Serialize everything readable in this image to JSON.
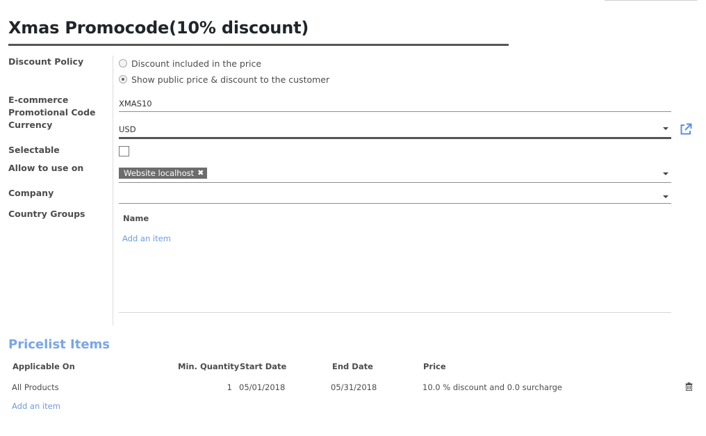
{
  "form": {
    "title": "Xmas Promocode(10% discount)",
    "labels": {
      "discount_policy": "Discount Policy",
      "promo_code_line1": "E-commerce",
      "promo_code_line2": "Promotional Code",
      "currency": "Currency",
      "selectable": "Selectable",
      "allow_to_use_on": "Allow to use on",
      "company": "Company",
      "country_groups": "Country Groups"
    },
    "discount_policy": {
      "options": [
        {
          "label": "Discount included in the price",
          "selected": false
        },
        {
          "label": "Show public price & discount to the customer",
          "selected": true
        }
      ]
    },
    "promo_code": "XMAS10",
    "currency": "USD",
    "selectable": false,
    "allow_to_use_on": {
      "tags": [
        "Website localhost"
      ],
      "remove_glyph": "✖"
    },
    "company": "",
    "country_groups": {
      "column_name": "Name",
      "add_item": "Add an item"
    }
  },
  "pricelist_items": {
    "title": "Pricelist Items",
    "columns": [
      "Applicable On",
      "Min. Quantity",
      "Start Date",
      "End Date",
      "Price"
    ],
    "rows": [
      {
        "applicable_on": "All Products",
        "min_quantity": "1",
        "start_date": "05/01/2018",
        "end_date": "05/31/2018",
        "price": "10.0 % discount and 0.0 surcharge"
      }
    ],
    "add_item": "Add an item"
  },
  "icons": {
    "external_link": "external-link-icon",
    "trash": "trash-icon",
    "dropdown": "caret-down-icon"
  },
  "colors": {
    "link": "#6e9be0",
    "section_title": "#7aa5e8",
    "tag_bg": "#6c6c6c"
  }
}
